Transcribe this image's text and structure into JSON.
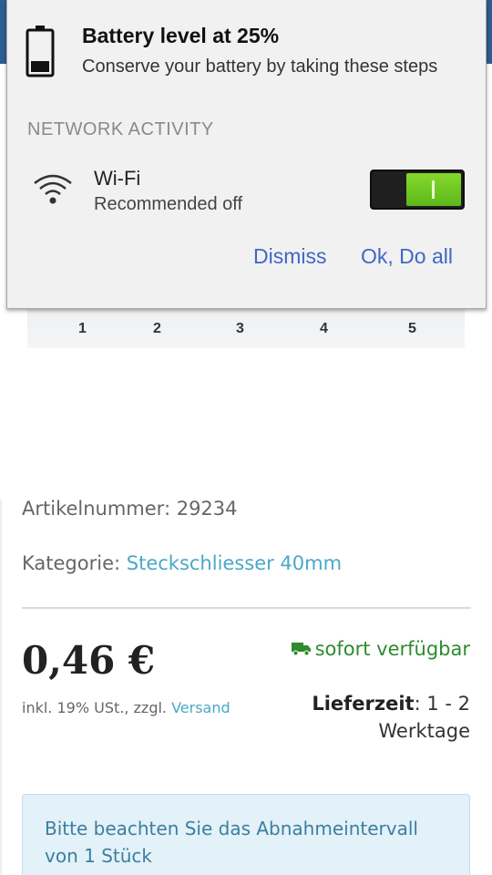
{
  "notification": {
    "title": "Battery level at 25%",
    "subtitle": "Conserve your battery by taking these steps",
    "battery_level_percent": 25,
    "section_header": "NETWORK ACTIVITY",
    "item": {
      "icon": "wifi-icon",
      "name": "Wi-Fi",
      "status": "Recommended off",
      "toggle_state": "on"
    },
    "dismiss_label": "Dismiss",
    "ok_label": "Ok, Do all"
  },
  "product": {
    "image_labels": [
      "1",
      "2",
      "3",
      "4",
      "5"
    ],
    "article_number": "Artikelnummer: 29234",
    "category_prefix": "Kategorie: ",
    "category_link": "Steckschliesser 40mm",
    "price": "0,46 €",
    "tax_text": "inkl. 19% USt., zzgl. ",
    "shipping_link": "Versand",
    "stock_status": "sofort verfügbar",
    "delivery_label": "Lieferzeit",
    "delivery_value": ": 1 - 2 Werktage",
    "notice": "Bitte beachten Sie das Abnahmeintervall von 1 Stück"
  },
  "colors": {
    "link": "#4aa8c7",
    "stock_green": "#2e8b2e",
    "dialog_button": "#3f67c7",
    "toggle_on": "#6ac41f",
    "notice_bg": "#e3f1f8"
  }
}
